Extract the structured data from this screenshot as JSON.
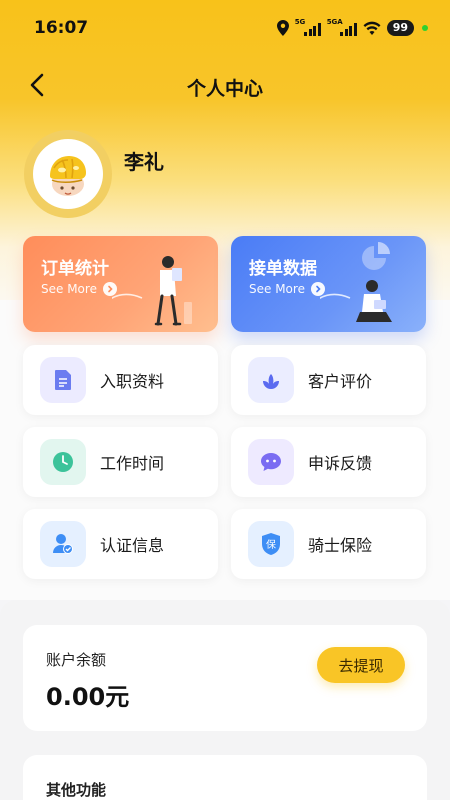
{
  "status_bar": {
    "time": "16:07",
    "signal_1": "5G",
    "signal_2": "5GA",
    "battery": "99"
  },
  "nav": {
    "title": "个人中心"
  },
  "profile": {
    "name": "李礼"
  },
  "stat_cards": [
    {
      "title": "订单统计",
      "more": "See More",
      "color": "#ff8d5a"
    },
    {
      "title": "接单数据",
      "more": "See More",
      "color": "#4a7cf6"
    }
  ],
  "menu": [
    {
      "label": "入职资料",
      "icon": "document-icon",
      "color": "#6b7cf0"
    },
    {
      "label": "客户评价",
      "icon": "flower-icon",
      "color": "#5b6bf0"
    },
    {
      "label": "工作时间",
      "icon": "clock-icon",
      "color": "#3cc39a"
    },
    {
      "label": "申诉反馈",
      "icon": "chat-bubble-icon",
      "color": "#7a6cf2"
    },
    {
      "label": "认证信息",
      "icon": "user-verified-icon",
      "color": "#3e8ef5"
    },
    {
      "label": "骑士保险",
      "icon": "shield-icon",
      "color": "#3e8ef5",
      "badge": "保"
    }
  ],
  "balance": {
    "label": "账户余额",
    "value": "0.00元",
    "withdraw_label": "去提现"
  },
  "other": {
    "title": "其他功能"
  },
  "colors": {
    "accent": "#f9c526"
  }
}
